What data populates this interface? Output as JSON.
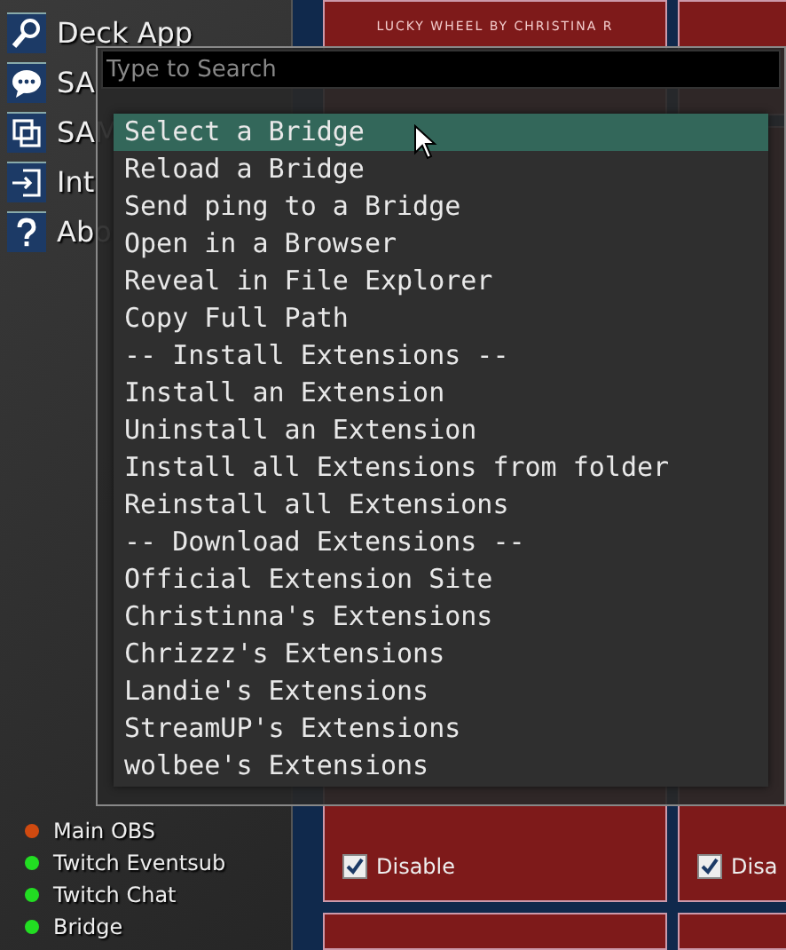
{
  "sidebar": {
    "items": [
      {
        "label": "Deck App"
      },
      {
        "label": "SA"
      },
      {
        "label": "SAM"
      },
      {
        "label": "Int"
      },
      {
        "label": "Abo"
      }
    ]
  },
  "connections": [
    {
      "label": "Main OBS",
      "color": "#d04a10"
    },
    {
      "label": "Twitch Eventsub",
      "color": "#22dd22"
    },
    {
      "label": "Twitch Chat",
      "color": "#22dd22"
    },
    {
      "label": "Bridge",
      "color": "#22dd22"
    }
  ],
  "decks": [
    {
      "caption": "LUCKY WHEEL BY CHRISTINA R"
    },
    {
      "disable_label": "Disable",
      "disabled": true
    },
    {
      "disable_label": "Disa",
      "disabled": true
    }
  ],
  "search": {
    "placeholder": "Type to Search"
  },
  "commands": [
    {
      "label": "Select a Bridge",
      "selected": true
    },
    {
      "label": "Reload a Bridge",
      "selected": false
    },
    {
      "label": "Send ping to a Bridge",
      "selected": false
    },
    {
      "label": "Open in a Browser",
      "selected": false
    },
    {
      "label": "Reveal in File Explorer",
      "selected": false
    },
    {
      "label": "Copy Full Path",
      "selected": false
    },
    {
      "label": "-- Install Extensions --",
      "selected": false
    },
    {
      "label": "Install an Extension",
      "selected": false
    },
    {
      "label": "Uninstall an Extension",
      "selected": false
    },
    {
      "label": "Install all Extensions from folder",
      "selected": false
    },
    {
      "label": "Reinstall all Extensions",
      "selected": false
    },
    {
      "label": "-- Download Extensions --",
      "selected": false
    },
    {
      "label": "Official Extension Site",
      "selected": false
    },
    {
      "label": "Christinna's Extensions",
      "selected": false
    },
    {
      "label": "Chrizzz's Extensions",
      "selected": false
    },
    {
      "label": "Landie's Extensions",
      "selected": false
    },
    {
      "label": "StreamUP's Extensions",
      "selected": false
    },
    {
      "label": "wolbee's Extensions",
      "selected": false
    }
  ]
}
